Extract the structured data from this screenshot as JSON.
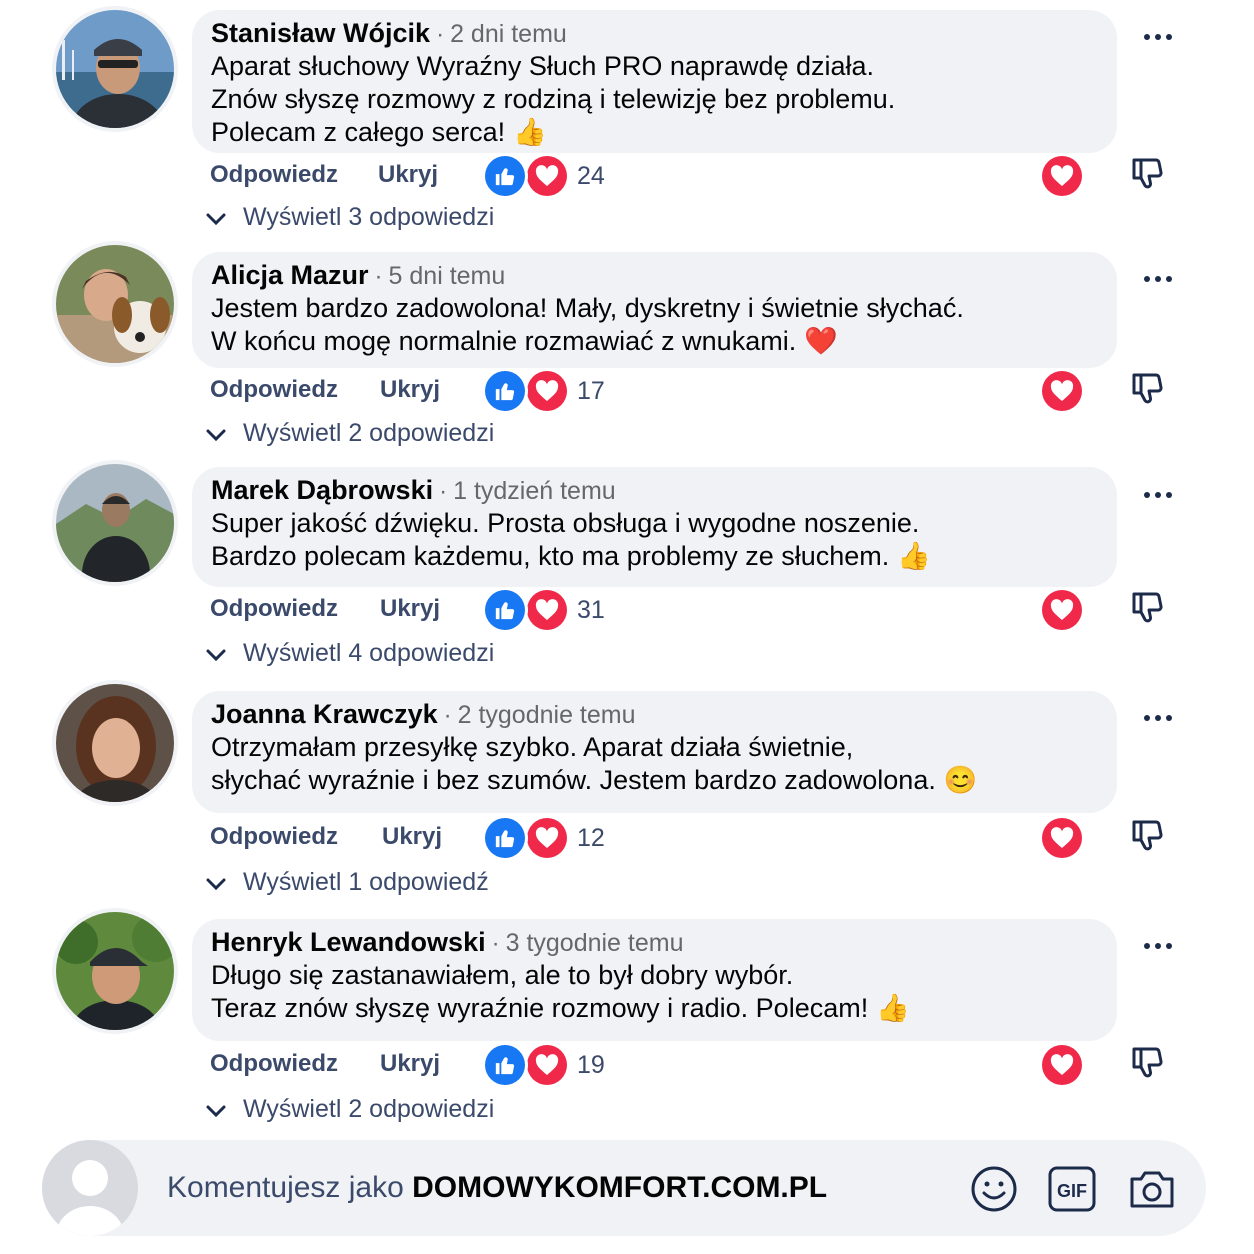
{
  "colors": {
    "like": "#1877f2",
    "heart": "#f02849",
    "bubble": "#f0f2f5",
    "muted": "#65676b",
    "action": "#3b4a6b"
  },
  "comments": [
    {
      "author": "Stanisław Wójcik",
      "time": "2 dni temu",
      "lines": [
        "Aparat słuchowy Wyraźny Słuch PRO naprawdę działa.",
        "Znów słyszę rozmowy z rodziną i telewizję bez problemu.",
        "Polecam z całego serca!"
      ],
      "emoji": "👍",
      "reply": "Odpowiedz",
      "hide": "Ukryj",
      "count": "24",
      "replies": "Wyświetl 3 odpowiedzi"
    },
    {
      "author": "Alicja Mazur",
      "time": "5 dni temu",
      "lines": [
        "Jestem bardzo zadowolona! Mały, dyskretny i świetnie słychać.",
        "W końcu mogę normalnie rozmawiać z wnukami."
      ],
      "emoji": "❤️",
      "reply": "Odpowiedz",
      "hide": "Ukryj",
      "count": "17",
      "replies": "Wyświetl 2 odpowiedzi"
    },
    {
      "author": "Marek Dąbrowski",
      "time": "1 tydzień temu",
      "lines": [
        "Super jakość dźwięku. Prosta obsługa i wygodne noszenie.",
        "Bardzo polecam każdemu, kto ma problemy ze słuchem."
      ],
      "emoji": "👍",
      "reply": "Odpowiedz",
      "hide": "Ukryj",
      "count": "31",
      "replies": "Wyświetl 4 odpowiedzi"
    },
    {
      "author": "Joanna Krawczyk",
      "time": "2 tygodnie temu",
      "lines": [
        "Otrzymałam przesyłkę szybko. Aparat działa świetnie,",
        "słychać wyraźnie i bez szumów. Jestem bardzo zadowolona."
      ],
      "emoji": "😊",
      "reply": "Odpowiedz",
      "hide": "Ukryj",
      "count": "12",
      "replies": "Wyświetl 1 odpowiedź"
    },
    {
      "author": "Henryk Lewandowski",
      "time": "3 tygodnie temu",
      "lines": [
        "Długo się zastanawiałem, ale to był dobry wybór.",
        "Teraz znów słyszę wyraźnie rozmowy i radio. Polecam!"
      ],
      "emoji": "👍",
      "reply": "Odpowiedz",
      "hide": "Ukryj",
      "count": "19",
      "replies": "Wyświetl 2 odpowiedzi"
    }
  ],
  "composer": {
    "prefix": "Komentujesz jako",
    "account": "DOMOWYKOMFORT.COM.PL",
    "gif_label": "GIF"
  },
  "icons": [
    "more-options-icon",
    "like-reaction-icon",
    "heart-reaction-icon",
    "heart-icon",
    "dislike-icon",
    "chevron-down-icon",
    "default-avatar-icon",
    "emoji-icon",
    "gif-icon",
    "camera-icon"
  ]
}
